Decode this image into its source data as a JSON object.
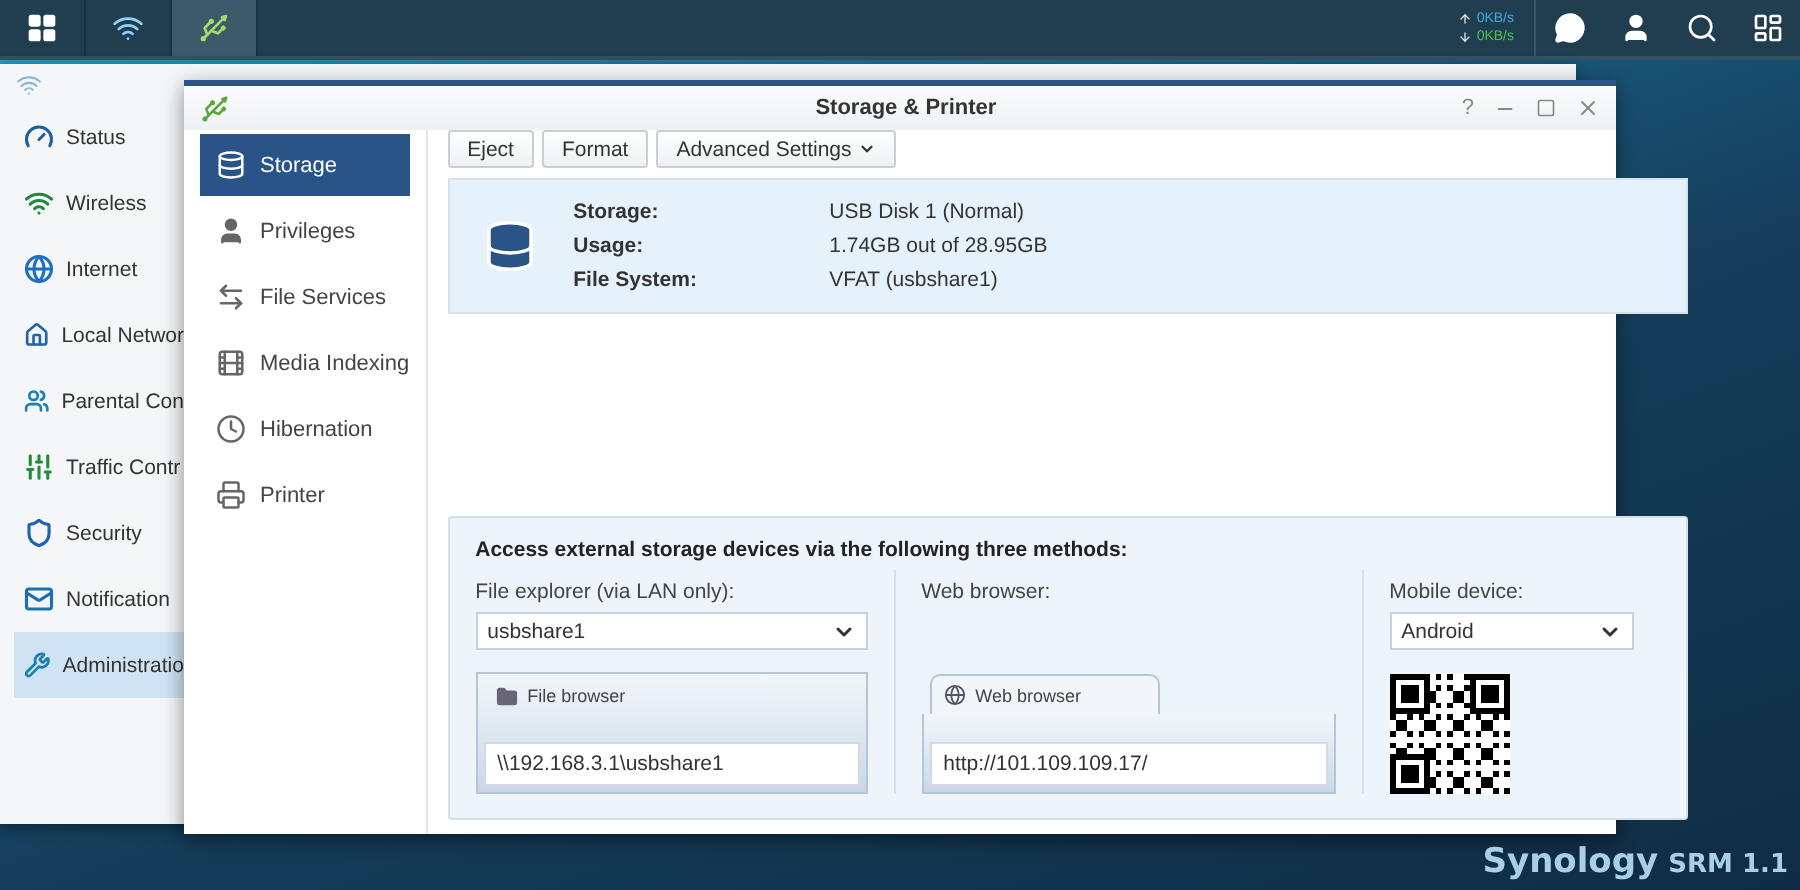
{
  "topbar": {
    "apps": [
      {
        "selected": false
      },
      {
        "selected": true
      }
    ],
    "net_speed": {
      "up": "0KB/s",
      "down": "0KB/s"
    }
  },
  "back_window": {
    "sidebar": [
      {
        "label": "Status",
        "selected": false
      },
      {
        "label": "Wireless",
        "selected": false
      },
      {
        "label": "Internet",
        "selected": false
      },
      {
        "label": "Local Networ",
        "selected": false
      },
      {
        "label": "Parental Con",
        "selected": false
      },
      {
        "label": "Traffic Contr",
        "selected": false
      },
      {
        "label": "Security",
        "selected": false
      },
      {
        "label": "Notification",
        "selected": false
      },
      {
        "label": "Administratio",
        "selected": true
      }
    ]
  },
  "window": {
    "title": "Storage & Printer",
    "help": "?",
    "nav": [
      {
        "label": "Storage",
        "selected": true
      },
      {
        "label": "Privileges",
        "selected": false
      },
      {
        "label": "File Services",
        "selected": false
      },
      {
        "label": "Media Indexing",
        "selected": false
      },
      {
        "label": "Hibernation",
        "selected": false
      },
      {
        "label": "Printer",
        "selected": false
      }
    ],
    "toolbar": [
      {
        "label": "Eject",
        "kind": "button"
      },
      {
        "label": "Format",
        "kind": "button"
      },
      {
        "label": "Advanced Settings",
        "kind": "menu"
      }
    ],
    "storage_info": [
      {
        "label": "Storage:",
        "value": "USB Disk 1 (Normal)"
      },
      {
        "label": "Usage:",
        "value": "1.74GB out of 28.95GB"
      },
      {
        "label": "File System:",
        "value": "VFAT (usbshare1)"
      }
    ],
    "access": {
      "heading": "Access external storage devices via the following three methods:",
      "columns": [
        {
          "kind": "explorer",
          "label": "File explorer (via LAN only):",
          "select": "usbshare1",
          "tab": "File browser",
          "address": "\\\\192.168.3.1\\usbshare1"
        },
        {
          "kind": "web",
          "label": "Web browser:",
          "tab": "Web browser",
          "address": "http://101.109.109.17/"
        },
        {
          "kind": "mobile",
          "label": "Mobile device:",
          "select": "Android"
        }
      ]
    }
  },
  "brand": {
    "name": "Synology",
    "product": "SRM 1.1"
  }
}
